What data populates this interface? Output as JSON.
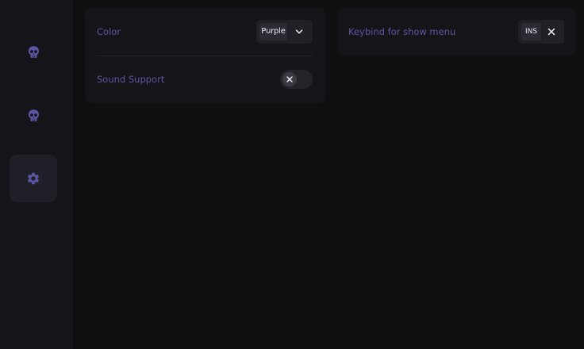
{
  "sidebar": {
    "items": [
      {
        "icon": "skull-icon",
        "active": false
      },
      {
        "icon": "skull-icon",
        "active": false
      },
      {
        "icon": "gear-icon",
        "active": true
      }
    ]
  },
  "settings": {
    "color": {
      "label": "Color",
      "selected": "Purple"
    },
    "sound": {
      "label": "Sound Support",
      "enabled": false
    },
    "keybind": {
      "label": "Keybind for show menu",
      "key": "INS"
    }
  },
  "colors": {
    "accent": "#5b55a3",
    "background": "#0f0f12",
    "sidebar": "#141419",
    "panel": "#151519"
  }
}
